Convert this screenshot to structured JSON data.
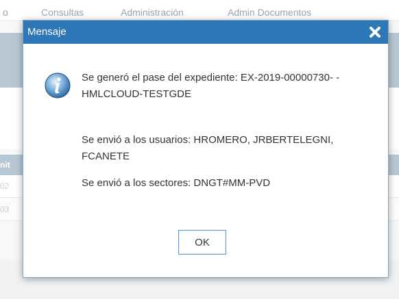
{
  "background": {
    "nav_items": [
      "o",
      "Consultas",
      "Administración",
      "Admin Documentos"
    ],
    "side_fragments": [
      "nit",
      "02",
      "03"
    ]
  },
  "dialog": {
    "title": "Mensaje",
    "close_label": "✖",
    "icon": "info-icon",
    "message_line1": "Se generó el pase del expediente: EX-2019-00000730- -HMLCLOUD-TESTGDE",
    "message_line2": "Se envió a los usuarios: HROMERO, JRBERTELEGNI, FCANETE",
    "message_line3": "Se envió a los sectores: DNGT#MM-PVD",
    "ok_label": "OK"
  },
  "colors": {
    "titlebar": "#2f78b8",
    "band": "#b8c7d4",
    "ok_border": "#5b98d0"
  }
}
